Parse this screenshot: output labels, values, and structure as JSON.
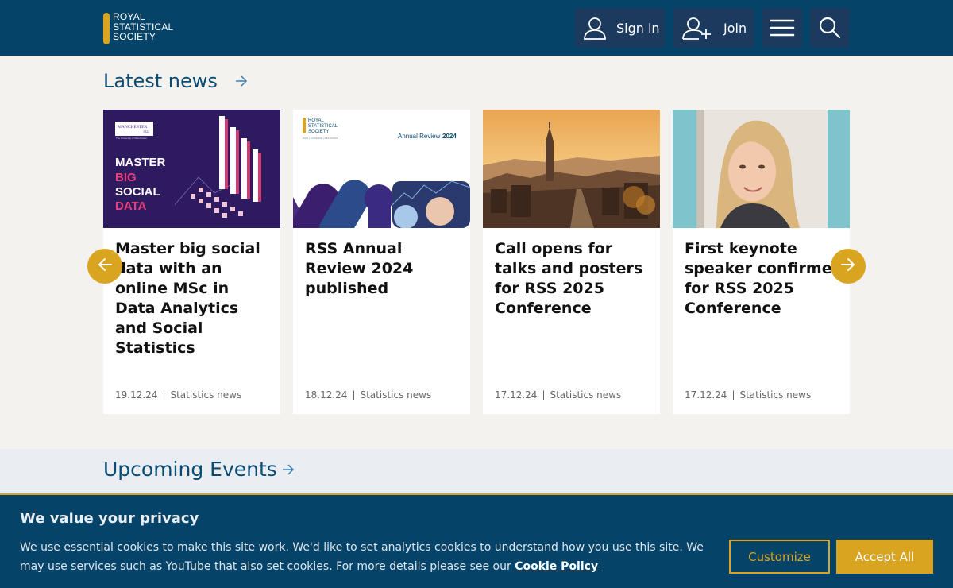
{
  "header": {
    "logo_lines": [
      "ROYAL",
      "STATISTICAL",
      "SOCIETY"
    ],
    "sign_in_label": "Sign in",
    "join_label": "Join",
    "menu_icon": "hamburger-menu-icon",
    "search_icon": "search-icon"
  },
  "latest_news": {
    "title": "Latest news",
    "cards": [
      {
        "title": "Master big social data with an online MSc in Data Analytics and Social Statistics",
        "date": "19.12.24",
        "category": "Statistics news",
        "image": {
          "badge_line1": "MANCHESTER",
          "badge_line2": "1824",
          "badge_line3": "The University of Manchester",
          "lines": [
            "MASTER",
            "BIG",
            "SOCIAL",
            "DATA"
          ]
        }
      },
      {
        "title": "RSS Annual Review 2024 published",
        "date": "18.12.24",
        "category": "Statistics news",
        "image": {
          "logo_lines": [
            "ROYAL",
            "STATISTICAL",
            "SOCIETY"
          ],
          "tagline": "DATA | EVIDENCE | DECISIONS",
          "label": "Annual Review",
          "year": "2024"
        }
      },
      {
        "title": "Call opens for talks and posters for RSS 2025 Conference",
        "date": "17.12.24",
        "category": "Statistics news"
      },
      {
        "title": "First keynote speaker confirmed for RSS 2025 Conference",
        "date": "17.12.24",
        "category": "Statistics news"
      }
    ]
  },
  "upcoming_events": {
    "title": "Upcoming Events"
  },
  "cookie_banner": {
    "title": "We value your privacy",
    "text": "We use essential cookies to make this site work. We'd like to set analytics cookies to understand how you use this site. We may use services such as YouTube that also set cookies. For more details please see our ",
    "link_label": "Cookie Policy",
    "customize_label": "Customize",
    "accept_label": "Accept All"
  },
  "colors": {
    "header_bg": "#054468",
    "accent": "#d9a521",
    "heading": "#0a4c73"
  }
}
